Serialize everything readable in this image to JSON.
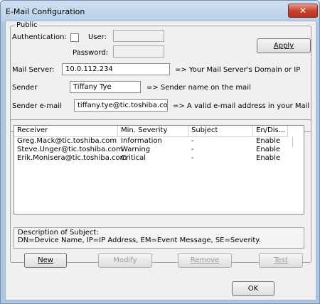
{
  "window": {
    "title": "E-Mail Configuration",
    "close_symbol": "✕"
  },
  "public_group": {
    "legend": "Public",
    "auth_label": "Authentication:",
    "auth_checked": false,
    "user_label": "User:",
    "user_value": "",
    "password_label": "Password:",
    "password_value": "",
    "apply_label": "Apply"
  },
  "mail_server": {
    "label": "Mail Server:",
    "value": "10.0.112.234",
    "hint": "=> Your Mail Server's Domain or IP"
  },
  "sender": {
    "label": "Sender",
    "value": "Tiffany Tye",
    "hint": "=> Sender name on the mail"
  },
  "sender_email": {
    "label": "Sender e-mail",
    "value": "tiffany.tye@tic.toshiba.com",
    "hint": "=> A valid e-mail address in your Mail"
  },
  "receivers": {
    "columns": [
      "Receiver",
      "Min. Severity",
      "Subject",
      "En/Dis..."
    ],
    "rows": [
      [
        "Greg.Mack@tic.toshiba.com",
        "Information",
        "-",
        "Enable"
      ],
      [
        "Steve.Unger@tic.toshiba.com",
        "Warning",
        "-",
        "Enable"
      ],
      [
        "Erik.Monisera@tic.toshiba.com",
        "Critical",
        "-",
        "Enable"
      ]
    ]
  },
  "description": {
    "line1": "Description of Subject:",
    "line2": "DN=Device Name, IP=IP Address, EM=Event Message, SE=Severity."
  },
  "buttons": {
    "new": "New",
    "modify": "Modify",
    "remove": "Remove",
    "test": "Test",
    "ok": "OK"
  }
}
